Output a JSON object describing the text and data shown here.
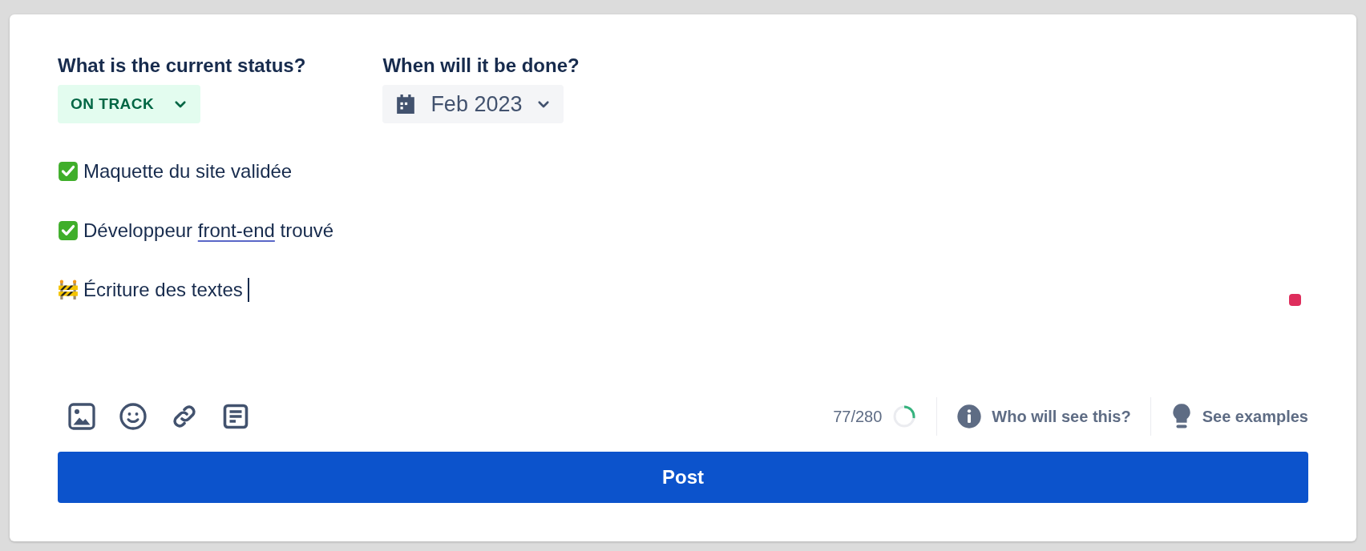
{
  "status": {
    "label": "What is the current status?",
    "value": "ON TRACK"
  },
  "due": {
    "label": "When will it be done?",
    "value": "Feb 2023"
  },
  "lines": [
    {
      "kind": "done",
      "caret": false,
      "parts": [
        {
          "text": "Maquette du site validée",
          "flagged": false
        }
      ]
    },
    {
      "kind": "done",
      "caret": false,
      "parts": [
        {
          "text": "Développeur ",
          "flagged": false
        },
        {
          "text": "front-end",
          "flagged": true
        },
        {
          "text": " trouvé",
          "flagged": false
        }
      ]
    },
    {
      "kind": "in_progress",
      "caret": true,
      "parts": [
        {
          "text": "Écriture des textes",
          "flagged": false
        }
      ]
    }
  ],
  "toolbar": {
    "tools": [
      {
        "kind": "image"
      },
      {
        "kind": "emoji"
      },
      {
        "kind": "link"
      },
      {
        "kind": "document"
      }
    ]
  },
  "counter": {
    "text": "77/280"
  },
  "links": [
    {
      "kind": "info",
      "label": "Who will see this?"
    },
    {
      "kind": "bulb",
      "label": "See examples"
    }
  ],
  "post_button": "Post"
}
